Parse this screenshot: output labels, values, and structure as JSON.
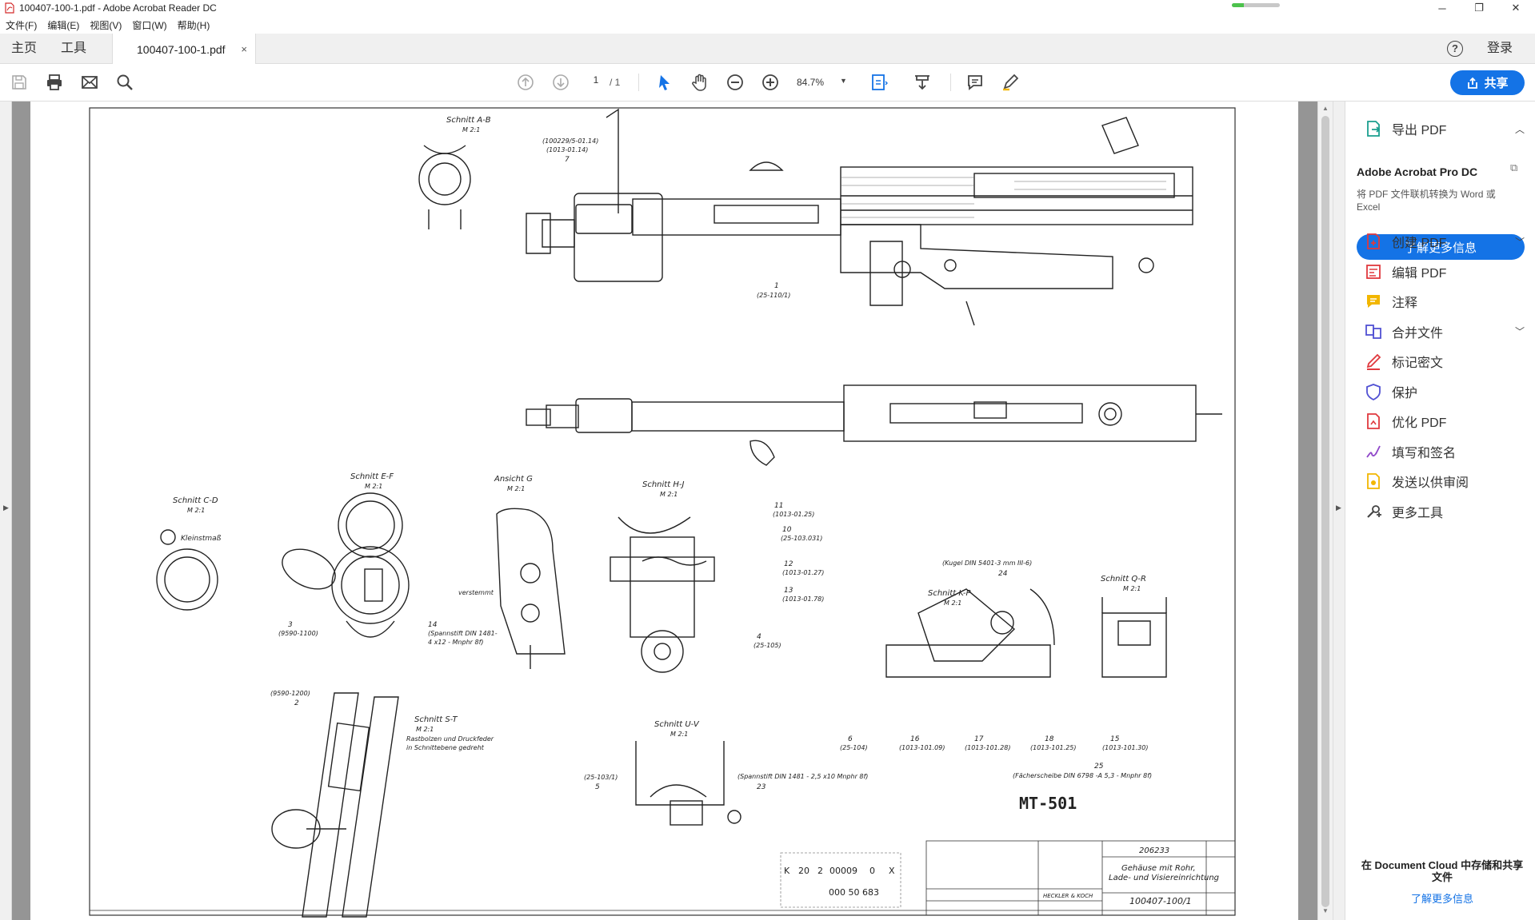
{
  "window": {
    "title": "100407-100-1.pdf - Adobe Acrobat Reader DC",
    "progress_fraction": 0.25,
    "minimize": "─",
    "maximize": "❐",
    "close": "✕"
  },
  "menu": [
    "文件(F)",
    "编辑(E)",
    "视图(V)",
    "窗口(W)",
    "帮助(H)"
  ],
  "tabs": {
    "home": "主页",
    "tools": "工具",
    "document": "100407-100-1.pdf",
    "close_symbol": "×",
    "login": "登录",
    "help": "?"
  },
  "toolbar": {
    "page_current": "1",
    "page_total": "/ 1",
    "zoom": "84.7%",
    "share_label": "共享"
  },
  "panel": {
    "export_pdf": "导出 PDF",
    "promo_title": "Adobe Acrobat Pro DC",
    "promo_desc": "将 PDF 文件联机转换为 Word 或 Excel",
    "promo_button": "了解更多信息",
    "items": [
      {
        "label": "创建 PDF",
        "icon": "create-pdf-icon",
        "color": "#e0393e",
        "chevron": true
      },
      {
        "label": "编辑 PDF",
        "icon": "edit-pdf-icon",
        "color": "#e0393e",
        "chevron": false
      },
      {
        "label": "注释",
        "icon": "comment-icon",
        "color": "#f2b600",
        "chevron": false
      },
      {
        "label": "合并文件",
        "icon": "combine-files-icon",
        "color": "#5151d3",
        "chevron": true
      },
      {
        "label": "标记密文",
        "icon": "redact-icon",
        "color": "#e0393e",
        "chevron": false
      },
      {
        "label": "保护",
        "icon": "protect-icon",
        "color": "#5151d3",
        "chevron": false
      },
      {
        "label": "优化 PDF",
        "icon": "optimize-pdf-icon",
        "color": "#e0393e",
        "chevron": false
      },
      {
        "label": "填写和签名",
        "icon": "fill-sign-icon",
        "color": "#8f46c9",
        "chevron": false
      },
      {
        "label": "发送以供审阅",
        "icon": "send-review-icon",
        "color": "#f2b600",
        "chevron": false
      },
      {
        "label": "更多工具",
        "icon": "more-tools-icon",
        "color": "#444444",
        "chevron": false
      }
    ],
    "cloud_text": "在 Document Cloud 中存储和共享文件",
    "cloud_link": "了解更多信息"
  },
  "drawing": {
    "labels": {
      "schnitt_ab": "Schnitt A-B",
      "scale_21": "M 2:1",
      "ref_top": "(100229/5-01.14)",
      "ref_top2": "(1013-01.14)",
      "num7": "7",
      "part1": "1",
      "part1_ref": "(25-110/1)",
      "schnitt_cd": "Schnitt C-D",
      "kleinstmass": "Kleinstmaß",
      "schnitt_ef": "Schnitt E-F",
      "ansicht_g": "Ansicht G",
      "versteml": "verstemmt",
      "schnitt_hj": "Schnitt H-J",
      "p11": "11",
      "p11_ref": "(1013-01.25)",
      "p10": "10",
      "p10_ref": "(25-103.031)",
      "p12": "12",
      "p12_ref": "(1013-01.27)",
      "p13": "13",
      "p13_ref": "(1013-01.78)",
      "p4": "4",
      "p4_ref": "(25-105)",
      "p3": "3",
      "p3_ref": "(9590-1100)",
      "p14": "14",
      "p14_ref": "(Spannstift DIN 1481-",
      "p14_ref2": "4 x12 - Mnphr 8f)",
      "kugel": "(Kugel DIN 5401-3 mm III-6)",
      "p24": "24",
      "schnitt_kp": "Schnitt K-P",
      "schnitt_qr": "Schnitt Q-R",
      "p6": "6",
      "p6_ref": "(25-104)",
      "p16": "16",
      "p16_ref": "(1013-101.09)",
      "p17": "17",
      "p17_ref": "(1013-101.28)",
      "p18": "18",
      "p18_ref": "(1013-101.25)",
      "p15": "15",
      "p15_ref": "(1013-101.30)",
      "p25": "25",
      "faecher": "(Fächerscheibe DIN 6798 -A 5,3 - Mnphr 8f)",
      "p2_ref": "(9590-1200)",
      "p2": "2",
      "schnitt_st": "Schnitt S-T",
      "rast": "Rastbolzen und Druckfeder",
      "rast2": "in Schnittebene gedreht",
      "schnitt_uv": "Schnitt U-V",
      "p5_ref": "(25-103/1)",
      "p5": "5",
      "p23_ref": "(Spannstift DIN 1481 - 2,5 x10 Mnphr 8f)",
      "p23": "23",
      "mt": "MT-501",
      "stamp_row1": [
        "K",
        "20",
        "2",
        "00009",
        "0",
        "X"
      ],
      "stamp_row2": "000 50 683",
      "drawing_no": "206233",
      "title_block": "Gehäuse mit Rohr,",
      "title_block2": "Lade- und Visiereinrichtung",
      "part_no": "100407-100/1",
      "maker": "HECKLER & KOCH"
    }
  }
}
